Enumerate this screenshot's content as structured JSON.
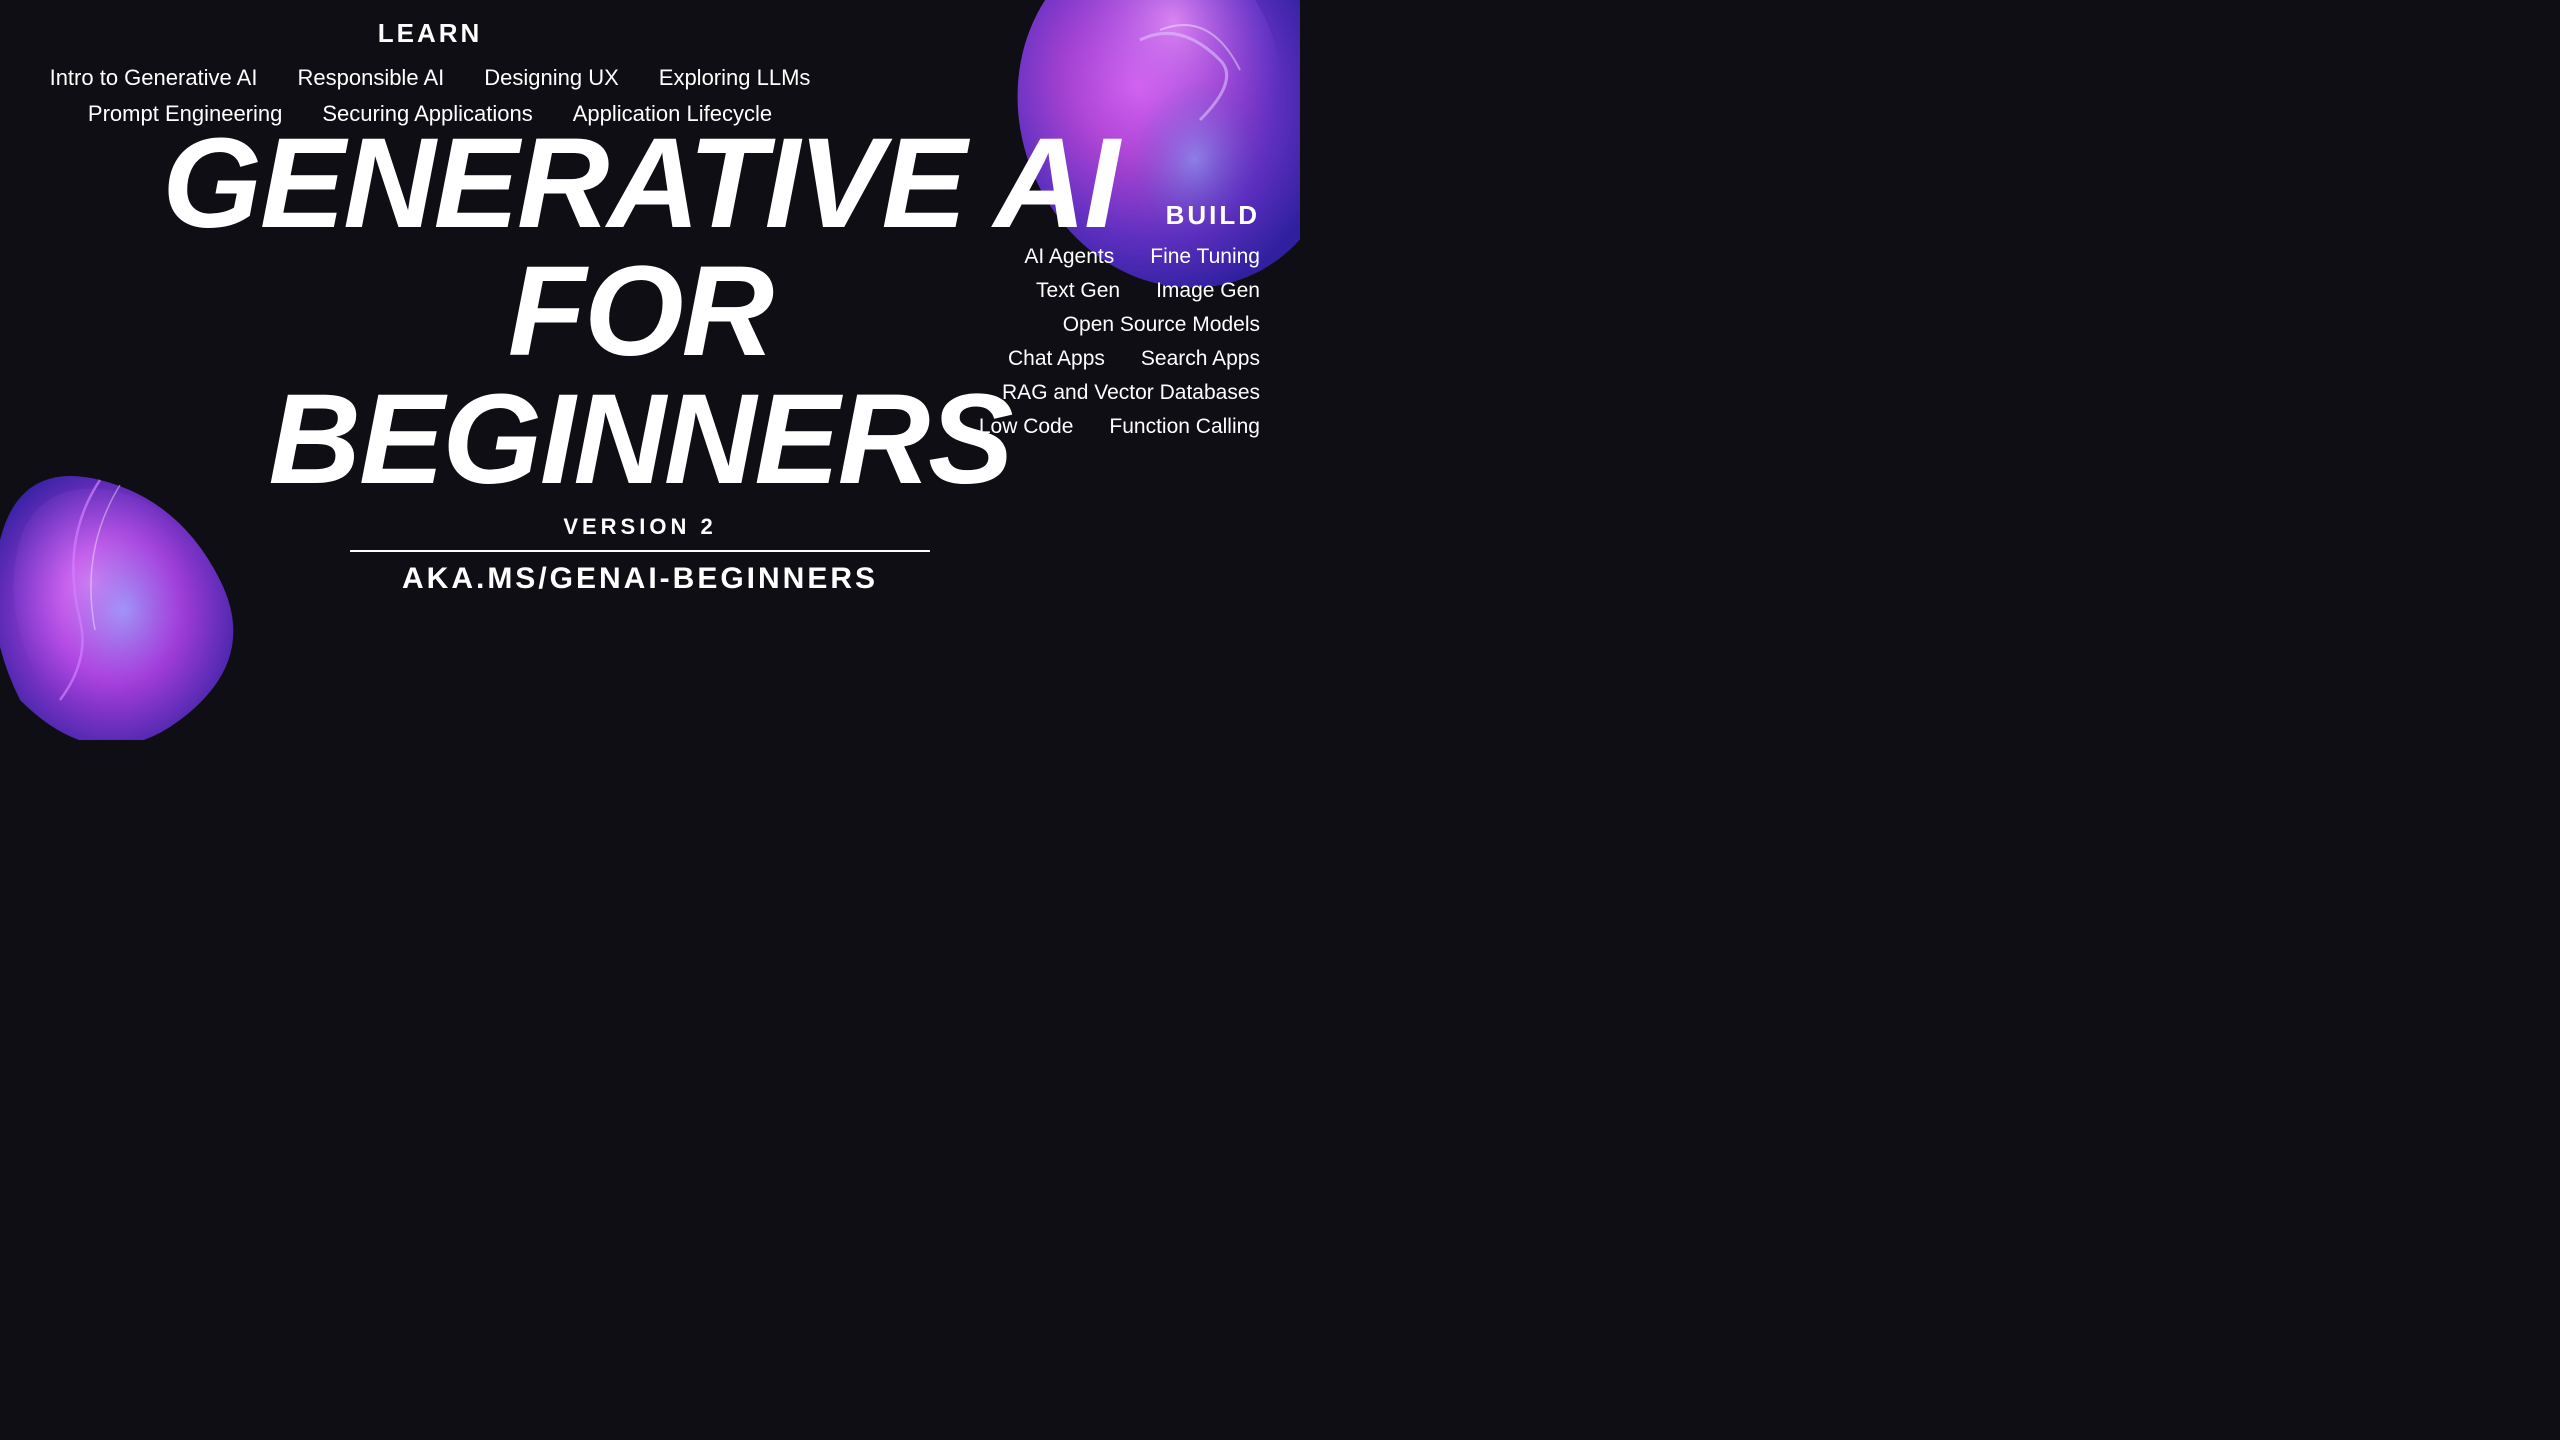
{
  "page": {
    "background": "#0e0e14"
  },
  "learn": {
    "label": "LEARN",
    "row1": [
      "Intro to Generative AI",
      "Responsible AI",
      "Designing UX",
      "Exploring LLMs"
    ],
    "row2": [
      "Prompt Engineering",
      "Securing Applications",
      "Application Lifecycle"
    ]
  },
  "main_title": {
    "line1": "GENERATIVE AI",
    "line2": "FOR",
    "line3": "BEGINNERS",
    "version": "VERSION 2",
    "url": "AKA.MS/GENAI-BEGINNERS"
  },
  "build": {
    "label": "BUILD",
    "row1": [
      "AI Agents",
      "Fine Tuning"
    ],
    "row2": [
      "Text Gen",
      "Image Gen"
    ],
    "row3_full": "Open Source Models",
    "row4": [
      "Chat Apps",
      "Search Apps"
    ],
    "row5_full": "RAG and Vector Databases",
    "row6": [
      "Low Code",
      "Function Calling"
    ]
  }
}
